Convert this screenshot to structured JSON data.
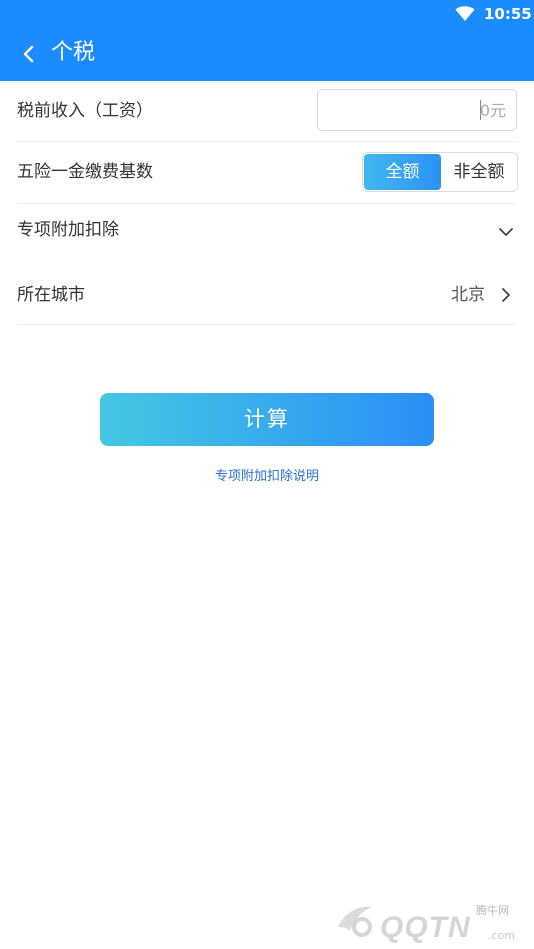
{
  "status_bar": {
    "time": "10:55",
    "icons": [
      "wifi-icon"
    ]
  },
  "header": {
    "title": "个税",
    "back_icon": "chevron-left-icon",
    "color": "#1a8cff"
  },
  "form": {
    "income": {
      "label": "税前收入（工资）",
      "value": "",
      "placeholder": "0元"
    },
    "insurance_base": {
      "label": "五险一金缴费基数",
      "options": [
        "全额",
        "非全额"
      ],
      "selected": "全额"
    },
    "special_deduction": {
      "label": "专项附加扣除",
      "icon": "chevron-down-icon"
    },
    "city": {
      "label": "所在城市",
      "value": "北京",
      "icon": "chevron-right-icon"
    }
  },
  "actions": {
    "calculate_label": "计算",
    "deduction_explain_link": "专项附加扣除说明"
  },
  "watermark": {
    "small_text": "腾牛网",
    "brand_text": "QQTN",
    "domain_text": ".com"
  },
  "colors": {
    "accent": "#1a8cff",
    "button_gradient_start": "#45c7e3",
    "button_gradient_end": "#2a8ff6",
    "link": "#2a6fd6"
  }
}
